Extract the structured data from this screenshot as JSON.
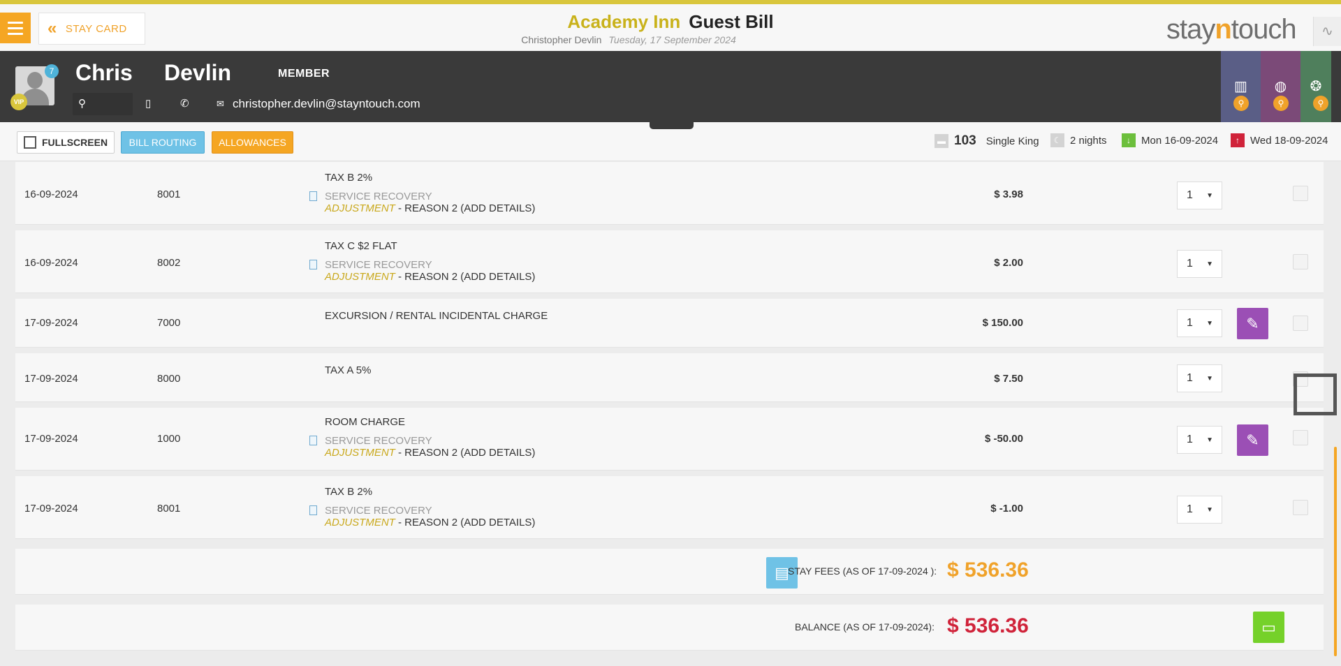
{
  "header": {
    "menu_icon": "hamburger-icon",
    "back_label": "STAY CARD",
    "hotel_name": "Academy Inn",
    "page_title": "Guest Bill",
    "guest_full_name": "Christopher Devlin",
    "date": "Tuesday, 17 September 2024",
    "brand_pre": "stay",
    "brand_mid": "n",
    "brand_post": "touch"
  },
  "guest": {
    "first_name": "Chris",
    "last_name": "Devlin",
    "membership": "MEMBER",
    "notification_count": "7",
    "vip_label": "VIP",
    "email": "christopher.devlin@stayntouch.com"
  },
  "toolbar": {
    "fullscreen_label": "FULLSCREEN",
    "bill_routing_label": "BILL ROUTING",
    "allowances_label": "ALLOWANCES",
    "room_number": "103",
    "room_type": "Single King",
    "nights": "2 nights",
    "arrival": "Mon 16-09-2024",
    "departure": "Wed 18-09-2024"
  },
  "colors": {
    "accent": "#f5a623",
    "hotel_gold": "#c9b21b",
    "balance_red": "#d0233a",
    "edit_purple": "#9b4fb5",
    "routing_blue": "#6fc2e6",
    "wallet_green": "#75d12a"
  },
  "charges": [
    {
      "date": "16-09-2024",
      "code": "8001",
      "name": "TAX B 2%",
      "sub": "SERVICE RECOVERY",
      "adj": "ADJUSTMENT",
      "reason": " - REASON 2 (ADD DETAILS)",
      "amount": "$ 3.98",
      "qty": "1"
    },
    {
      "date": "16-09-2024",
      "code": "8002",
      "name": "TAX C $2 FLAT",
      "sub": "SERVICE RECOVERY",
      "adj": "ADJUSTMENT",
      "reason": " - REASON 2 (ADD DETAILS)",
      "amount": "$ 2.00",
      "qty": "1"
    },
    {
      "date": "17-09-2024",
      "code": "7000",
      "name": "EXCURSION / RENTAL INCIDENTAL CHARGE",
      "amount": "$ 150.00",
      "qty": "1"
    },
    {
      "date": "17-09-2024",
      "code": "8000",
      "name": "TAX A 5%",
      "amount": "$ 7.50",
      "qty": "1"
    },
    {
      "date": "17-09-2024",
      "code": "1000",
      "name": "ROOM CHARGE",
      "sub": "SERVICE RECOVERY",
      "adj": "ADJUSTMENT",
      "reason": " - REASON 2 (ADD DETAILS)",
      "amount": "$ -50.00",
      "qty": "1"
    },
    {
      "date": "17-09-2024",
      "code": "8001",
      "name": "TAX B 2%",
      "sub": "SERVICE RECOVERY",
      "adj": "ADJUSTMENT",
      "reason": " - REASON 2 (ADD DETAILS)",
      "amount": "$ -1.00",
      "qty": "1"
    }
  ],
  "totals": {
    "stay_fees_label": "STAY FEES (AS OF  17-09-2024 ):",
    "stay_fees_value": "$ 536.36",
    "balance_label": "BALANCE (AS OF  17-09-2024):",
    "balance_value": "$ 536.36"
  }
}
